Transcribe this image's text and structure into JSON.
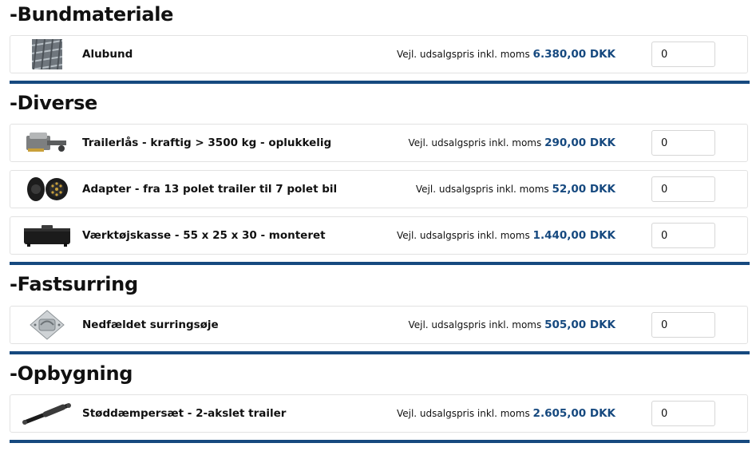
{
  "sections": [
    {
      "title": "-Bundmateriale",
      "items": [
        {
          "name": "Alubund",
          "price_label": "Vejl. udsalgspris inkl. moms",
          "price": "6.380,00 DKK",
          "qty": "0",
          "icon": "aluminium-floor-icon"
        }
      ]
    },
    {
      "title": "-Diverse",
      "items": [
        {
          "name": "Trailerlås - kraftig > 3500 kg - oplukkelig",
          "price_label": "Vejl. udsalgspris inkl. moms",
          "price": "290,00 DKK",
          "qty": "0",
          "icon": "trailer-lock-icon"
        },
        {
          "name": "Adapter - fra 13 polet trailer til 7 polet bil",
          "price_label": "Vejl. udsalgspris inkl. moms",
          "price": "52,00 DKK",
          "qty": "0",
          "icon": "plug-adapter-icon"
        },
        {
          "name": "Værktøjskasse - 55 x 25 x 30 - monteret",
          "price_label": "Vejl. udsalgspris inkl. moms",
          "price": "1.440,00 DKK",
          "qty": "0",
          "icon": "toolbox-icon"
        }
      ]
    },
    {
      "title": "-Fastsurring",
      "items": [
        {
          "name": "Nedfældet surringsøje",
          "price_label": "Vejl. udsalgspris inkl. moms",
          "price": "505,00 DKK",
          "qty": "0",
          "icon": "lashing-eye-icon"
        }
      ]
    },
    {
      "title": "-Opbygning",
      "items": [
        {
          "name": "Støddæmpersæt - 2-akslet trailer",
          "price_label": "Vejl. udsalgspris inkl. moms",
          "price": "2.605,00 DKK",
          "qty": "0",
          "icon": "shock-absorber-icon"
        }
      ]
    }
  ],
  "colors": {
    "accent": "#16497f",
    "border": "#e2e2e2"
  }
}
